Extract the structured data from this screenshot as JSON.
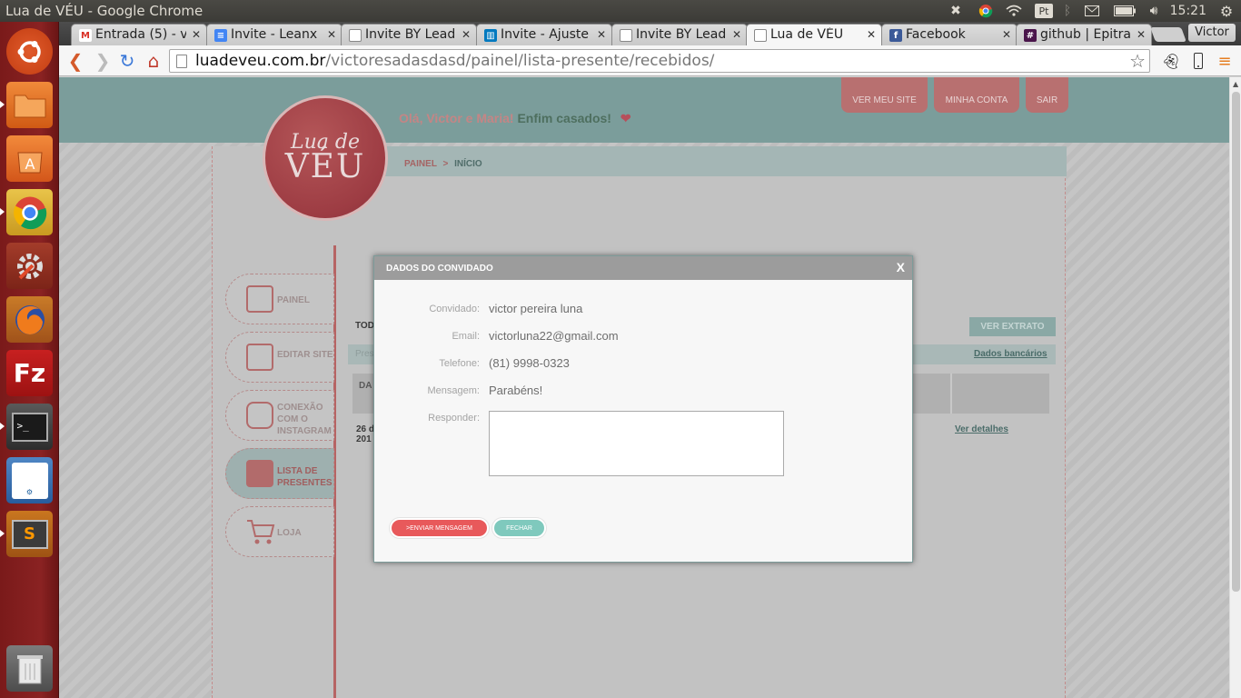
{
  "os": {
    "window_title": "Lua de VÉU - Google Chrome",
    "clock": "15:21",
    "user": "Victor",
    "tray": {
      "pt_label": "Pt"
    }
  },
  "browser": {
    "tabs": [
      {
        "label": "Entrada (5) - v",
        "icon": "gmail-icon",
        "color": "#d93025"
      },
      {
        "label": "Invite - Leanx",
        "icon": "docs-icon",
        "color": "#4285f4"
      },
      {
        "label": "Invite BY Lead",
        "icon": "page-icon",
        "color": "#ffffff"
      },
      {
        "label": "Invite - Ajuste",
        "icon": "trello-icon",
        "color": "#0079bf"
      },
      {
        "label": "Invite BY Lead",
        "icon": "page-icon",
        "color": "#ffffff"
      },
      {
        "label": "Lua de VÉU",
        "icon": "page-icon",
        "color": "#ffffff"
      },
      {
        "label": "Facebook",
        "icon": "facebook-icon",
        "color": "#3b5998"
      },
      {
        "label": "github | Epitra",
        "icon": "hash-icon",
        "color": "#4a154b"
      }
    ],
    "url_host": "luadeveu.com.br",
    "url_path": "/victoresadasdasd/painel/lista-presente/recebidos/"
  },
  "site": {
    "top_nav": [
      "VER MEU SITE",
      "MINHA CONTA",
      "SAIR"
    ],
    "greeting_names": "Olá, Victor e Maria!",
    "greeting_rest": "Enfim casados!",
    "breadcrumb": {
      "root": "PAINEL",
      "sep": ">",
      "current": "INÍCIO"
    },
    "logo": {
      "line1": "Lua de",
      "line2": "VÉU"
    },
    "sidebar": [
      {
        "label": "PAINEL"
      },
      {
        "label": "EDITAR SITE"
      },
      {
        "label": "CONEXÃO COM O INSTAGRAM"
      },
      {
        "label": "LISTA DE PRESENTES"
      },
      {
        "label": "LOJA"
      }
    ],
    "list": {
      "title": "TOD",
      "ver_extrato": "VER EXTRATO",
      "tab_text": "Pres",
      "dados_bancarios": "Dados bancários",
      "col_header": "DA",
      "row_date": "26 d",
      "row_year": "201",
      "ver_detalhes": "Ver detalhes"
    }
  },
  "modal": {
    "title": "DADOS DO CONVIDADO",
    "close": "X",
    "fields": [
      {
        "label": "Convidado:",
        "value": "victor pereira luna"
      },
      {
        "label": "Email:",
        "value": "victorluna22@gmail.com"
      },
      {
        "label": "Telefone:",
        "value": "(81) 9998-0323"
      },
      {
        "label": "Mensagem:",
        "value": "Parabéns!"
      }
    ],
    "reply_label": "Responder:",
    "reply_value": "",
    "send_label": ">ENVIAR MENSAGEM",
    "close_label": "FECHAR",
    "colors": {
      "send": "#e8595b",
      "close": "#7fc9bd",
      "header": "#9c9c9c"
    }
  }
}
